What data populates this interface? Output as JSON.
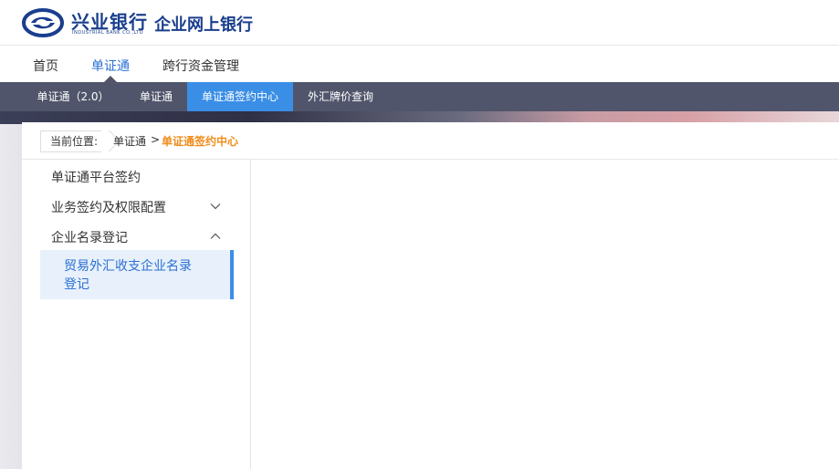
{
  "header": {
    "logo_cn": "兴业银行",
    "logo_en": "INDUSTRIAL BANK CO.,LTD",
    "product_name": "企业网上银行"
  },
  "main_nav": {
    "items": [
      {
        "label": "首页"
      },
      {
        "label": "单证通"
      },
      {
        "label": "跨行资金管理"
      }
    ],
    "active": "单证通"
  },
  "sub_nav": {
    "items": [
      {
        "label": "单证通（2.0）"
      },
      {
        "label": "单证通"
      },
      {
        "label": "单证通签约中心"
      },
      {
        "label": "外汇牌价查询"
      }
    ],
    "active": "单证通签约中心"
  },
  "breadcrumb": {
    "label": "当前位置:",
    "parent": "单证通",
    "separator": ">",
    "current": "单证通签约中心"
  },
  "sidebar": {
    "items": [
      {
        "label": "单证通平台签约"
      },
      {
        "label": "业务签约及权限配置",
        "icon": "chevron-down-icon"
      },
      {
        "label": "企业名录登记",
        "icon": "chevron-up-icon"
      }
    ],
    "submenu": {
      "label": "贸易外汇收支企业名录登记"
    }
  },
  "colors": {
    "brand_blue": "#1a3e8e",
    "accent_blue": "#3a8ee6",
    "subnav_bg": "#50556b",
    "breadcrumb_current": "#f08c1a"
  }
}
